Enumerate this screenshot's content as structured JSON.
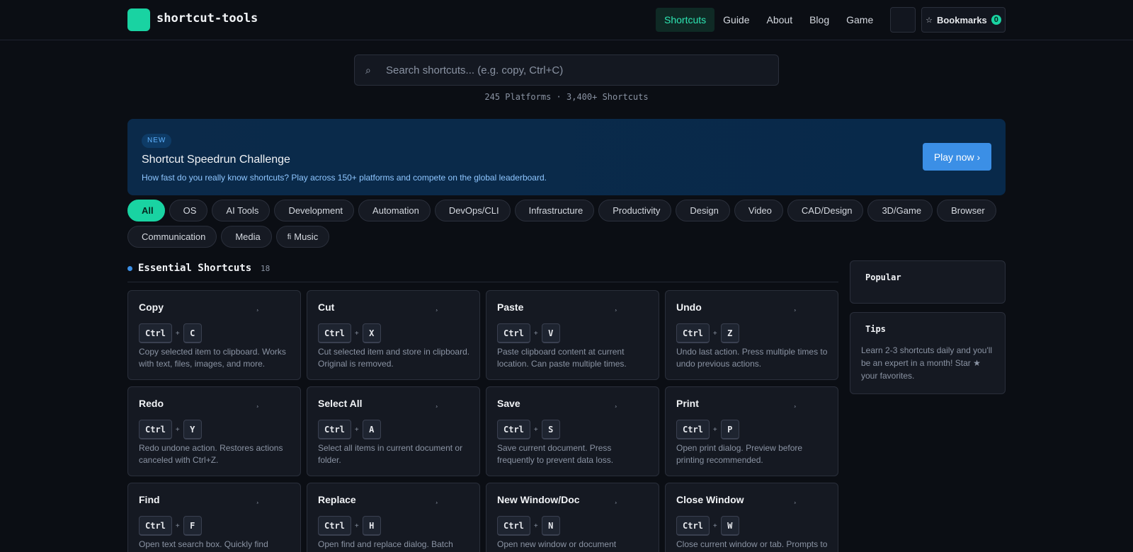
{
  "header": {
    "logo_icon": "",
    "brand": "shortcut-tools",
    "nav": [
      {
        "label": "Shortcuts",
        "active": true
      },
      {
        "label": "Guide"
      },
      {
        "label": "About"
      },
      {
        "label": "Blog"
      },
      {
        "label": "Game"
      }
    ],
    "theme_icon": "",
    "bookmarks_icon": "☆",
    "bookmarks_label": "Bookmarks",
    "bookmarks_count": "0"
  },
  "search": {
    "icon": "⌕",
    "placeholder": "Search shortcuts... (e.g. copy, Ctrl+C)",
    "value": ""
  },
  "stats": "245 Platforms · 3,400+ Shortcuts",
  "banner": {
    "badge": "NEW",
    "title": "Shortcut Speedrun Challenge",
    "description": "How fast do you really know shortcuts? Play across 150+ platforms and compete on the global leaderboard.",
    "cta": "Play now ›"
  },
  "categories": [
    {
      "icon": "",
      "label": "All",
      "active": true
    },
    {
      "icon": "",
      "label": "OS"
    },
    {
      "icon": "",
      "label": "AI Tools"
    },
    {
      "icon": "",
      "label": "Development"
    },
    {
      "icon": "",
      "label": "Automation"
    },
    {
      "icon": "",
      "label": "DevOps/CLI"
    },
    {
      "icon": "",
      "label": "Infrastructure"
    },
    {
      "icon": "",
      "label": "Productivity"
    },
    {
      "icon": "",
      "label": "Design"
    },
    {
      "icon": "",
      "label": "Video"
    },
    {
      "icon": "",
      "label": "CAD/Design"
    },
    {
      "icon": "",
      "label": "3D/Game"
    },
    {
      "icon": "",
      "label": "Browser"
    },
    {
      "icon": "",
      "label": "Communication"
    },
    {
      "icon": "",
      "label": "Media"
    },
    {
      "icon": "fi",
      "label": "Music"
    }
  ],
  "section": {
    "title": "Essential Shortcuts",
    "count": "18"
  },
  "shortcuts": [
    {
      "title": "Copy",
      "keys": [
        "Ctrl",
        "C"
      ],
      "desc": "Copy selected item to clipboard. Works with text, files, images, and more."
    },
    {
      "title": "Cut",
      "keys": [
        "Ctrl",
        "X"
      ],
      "desc": "Cut selected item and store in clipboard. Original is removed."
    },
    {
      "title": "Paste",
      "keys": [
        "Ctrl",
        "V"
      ],
      "desc": "Paste clipboard content at current location. Can paste multiple times."
    },
    {
      "title": "Undo",
      "keys": [
        "Ctrl",
        "Z"
      ],
      "desc": "Undo last action. Press multiple times to undo previous actions."
    },
    {
      "title": "Redo",
      "keys": [
        "Ctrl",
        "Y"
      ],
      "desc": "Redo undone action. Restores actions canceled with Ctrl+Z."
    },
    {
      "title": "Select All",
      "keys": [
        "Ctrl",
        "A"
      ],
      "desc": "Select all items in current document or folder."
    },
    {
      "title": "Save",
      "keys": [
        "Ctrl",
        "S"
      ],
      "desc": "Save current document. Press frequently to prevent data loss."
    },
    {
      "title": "Print",
      "keys": [
        "Ctrl",
        "P"
      ],
      "desc": "Open print dialog. Preview before printing recommended."
    },
    {
      "title": "Find",
      "keys": [
        "Ctrl",
        "F"
      ],
      "desc": "Open text search box. Quickly find"
    },
    {
      "title": "Replace",
      "keys": [
        "Ctrl",
        "H"
      ],
      "desc": "Open find and replace dialog. Batch"
    },
    {
      "title": "New Window/Doc",
      "keys": [
        "Ctrl",
        "N"
      ],
      "desc": "Open new window or document"
    },
    {
      "title": "Close Window",
      "keys": [
        "Ctrl",
        "W"
      ],
      "desc": "Close current window or tab. Prompts to"
    }
  ],
  "card_icons": {
    "bookmark": "¸",
    "copy": ""
  },
  "sidebar": {
    "popular": {
      "icon": "",
      "title": "Popular"
    },
    "tips": {
      "icon": "",
      "title": "Tips",
      "text": "Learn 2-3 shortcuts daily and you'll be an expert in a month! Star ★ your favorites."
    }
  },
  "colors": {
    "accent": "#19d3a2",
    "background": "#0b0e14",
    "card": "#151922",
    "banner": "#0b2a4a",
    "cta": "#3b8fe6"
  }
}
